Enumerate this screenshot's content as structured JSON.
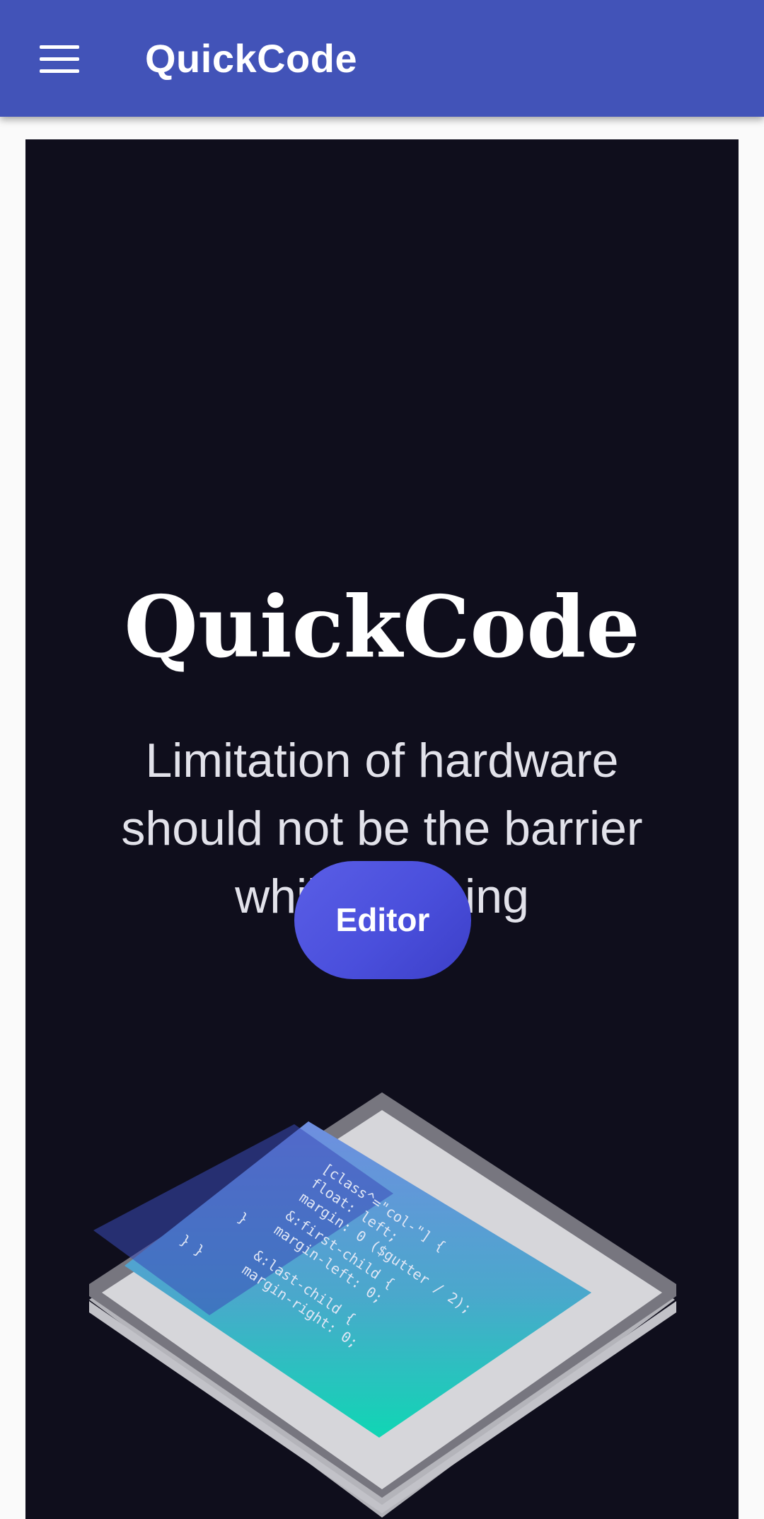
{
  "app_bar": {
    "title": "QuickCode",
    "menu_icon": "hamburger-menu-icon",
    "background": "#4253b8"
  },
  "hero": {
    "title": "QuickCode",
    "tagline": "Limitation of hardware should not be the barrier while learning",
    "editor_button_label": "Editor",
    "background": "#0f0e1c",
    "accent": "#4a4fdc",
    "illustration": {
      "name": "code-tablet-illustration",
      "code_lines": [
        "[class^=\"col-\"] {",
        "float: left;",
        "margin: 0 ($gutter / 2);",
        "&:first-child {",
        "margin-left: 0;",
        "}",
        "&:last-child {",
        "margin-right: 0;",
        "}  }"
      ]
    }
  }
}
